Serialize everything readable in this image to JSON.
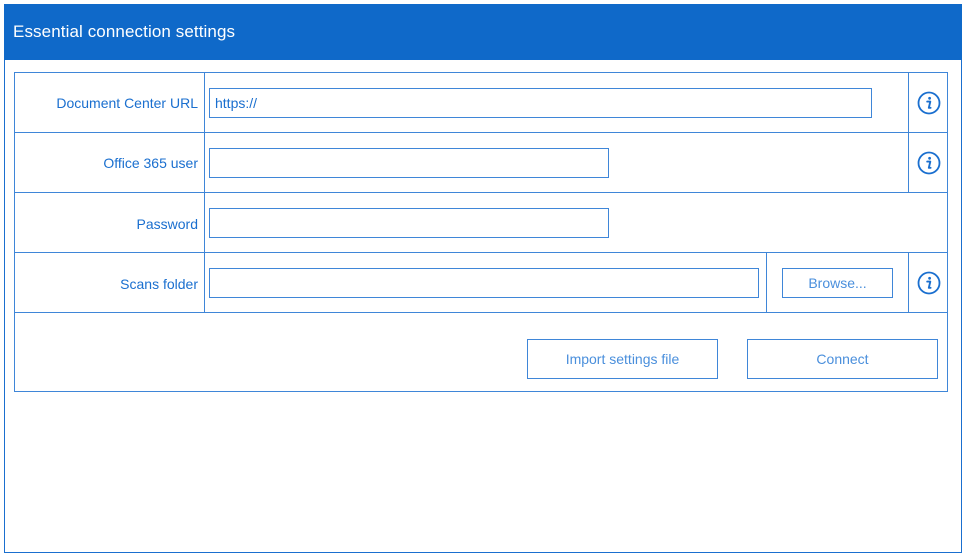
{
  "header": {
    "title": "Essential connection settings"
  },
  "form": {
    "document_center_url": {
      "label": "Document Center URL",
      "value": "https://"
    },
    "office365_user": {
      "label": "Office 365 user",
      "value": ""
    },
    "password": {
      "label": "Password",
      "value": ""
    },
    "scans_folder": {
      "label": "Scans folder",
      "value": "",
      "browse_label": "Browse..."
    }
  },
  "actions": {
    "import_label": "Import settings file",
    "connect_label": "Connect"
  },
  "icons": {
    "info": "info-circle-icon"
  },
  "colors": {
    "accent": "#0f69c9",
    "border": "#3f86d8",
    "text": "#1a6fcf"
  }
}
